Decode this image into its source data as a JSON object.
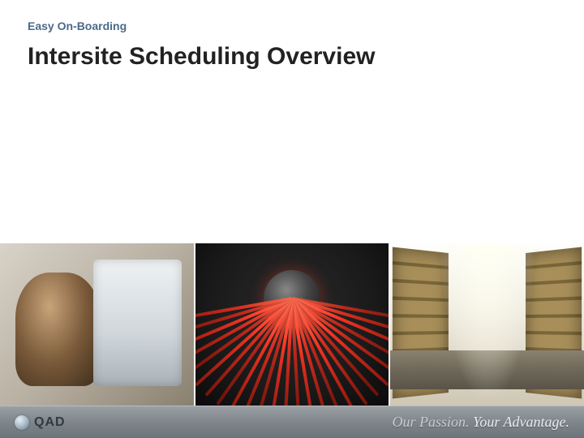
{
  "header": {
    "kicker": "Easy On-Boarding",
    "title": "Intersite Scheduling Overview"
  },
  "images": {
    "panel1_alt": "Two colleagues reviewing data on a monitor",
    "panel2_alt": "Bundle of red network cables",
    "panel3_alt": "Warehouse aisle with stacked boxes"
  },
  "footer": {
    "brand": "QAD",
    "tagline_strong": "Our Passion.",
    "tagline_rest": " Your Advantage."
  },
  "colors": {
    "kicker": "#4a6a8a",
    "cable": "#e03020"
  }
}
